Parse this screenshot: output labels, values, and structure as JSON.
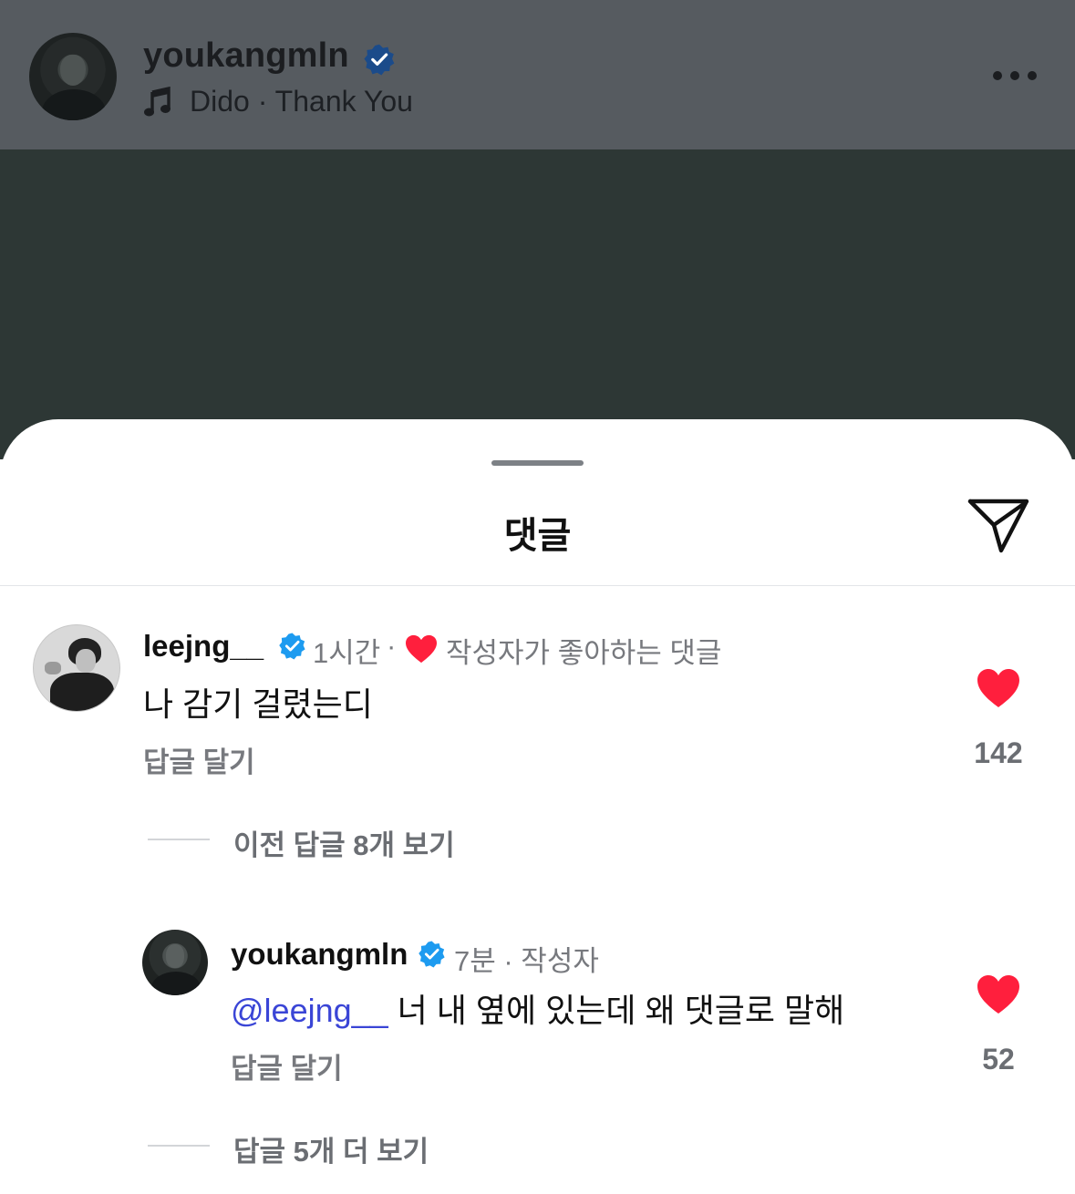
{
  "post": {
    "username": "youkangmln",
    "music": "Dido · Thank You"
  },
  "comments_sheet": {
    "title": "댓글",
    "comments": [
      {
        "username": "leejng__",
        "time": "1시간",
        "separator": "·",
        "creator_liked_label": "작성자가 좋아하는 댓글",
        "text": "나 감기 걸렸는디",
        "reply_label": "답글 달기",
        "like_count": "142"
      },
      {
        "username": "youkangmln",
        "meta": "7분 · 작성자",
        "mention": "@leejng__",
        "text": " 너 내 옆에 있는데 왜 댓글로 말해",
        "reply_label": "답글 달기",
        "like_count": "52"
      }
    ],
    "previous_replies_label": "이전 답글 8개 보기",
    "more_replies_label": "답글 5개 더 보기"
  },
  "colors": {
    "verified": "#1d9bf0",
    "heart": "#ff1f3d",
    "mention": "#3a45d6",
    "dim_overlay": "#565b60"
  }
}
